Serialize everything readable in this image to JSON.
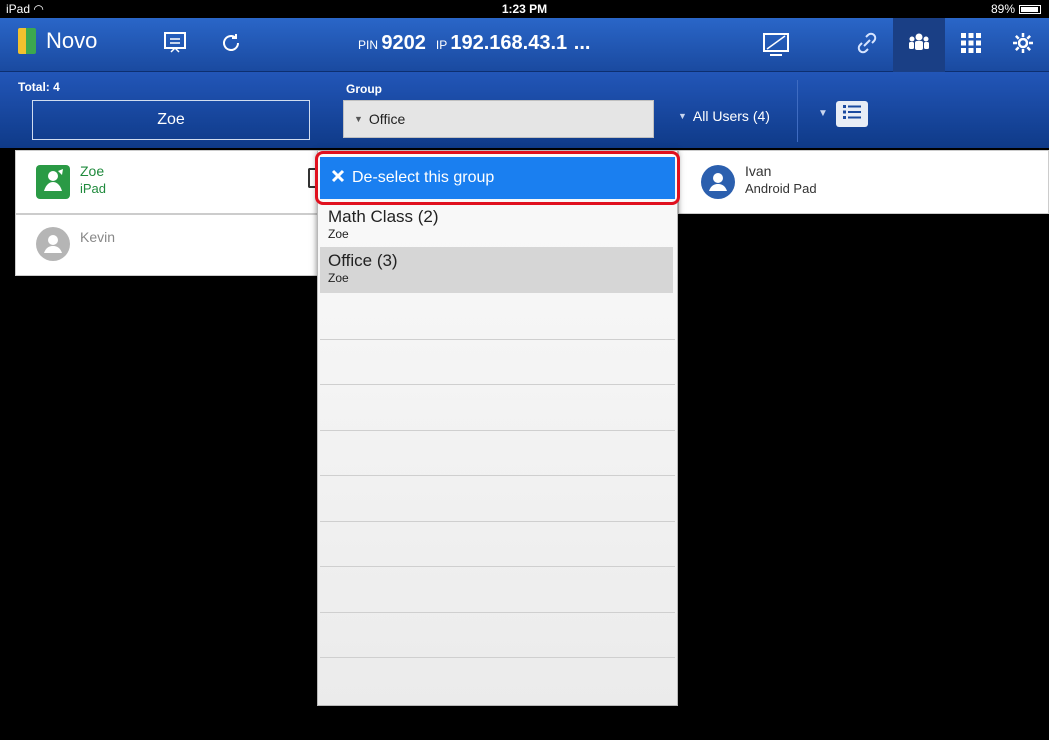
{
  "status_bar": {
    "device": "iPad",
    "time": "1:23 PM",
    "battery": "89%",
    "battery_level": 0.89
  },
  "toolbar": {
    "app_name": "Novo",
    "pin_label": "PIN",
    "pin_value": "9202",
    "ip_label": "IP",
    "ip_value": "192.168.43.1",
    "ip_more": "..."
  },
  "subbar": {
    "total_label": "Total: 4",
    "current_user": "Zoe",
    "group_label": "Group",
    "group_selected": "Office",
    "all_users": "All Users (4)"
  },
  "users": [
    {
      "name": "Zoe",
      "device": "iPad"
    },
    {
      "name": "Kevin",
      "device": ""
    },
    {
      "name": "Ivan",
      "device": "Android Pad"
    }
  ],
  "dropdown": {
    "deselect_label": "De-select this group",
    "items": [
      {
        "title": "Math Class (2)",
        "subtitle": "Zoe"
      },
      {
        "title": "Office (3)",
        "subtitle": "Zoe"
      }
    ]
  },
  "colors": {
    "accent": "#1a7ff0",
    "toolbar": "#2a66c8",
    "highlight": "#e0101e",
    "online": "#1f8a3c"
  }
}
